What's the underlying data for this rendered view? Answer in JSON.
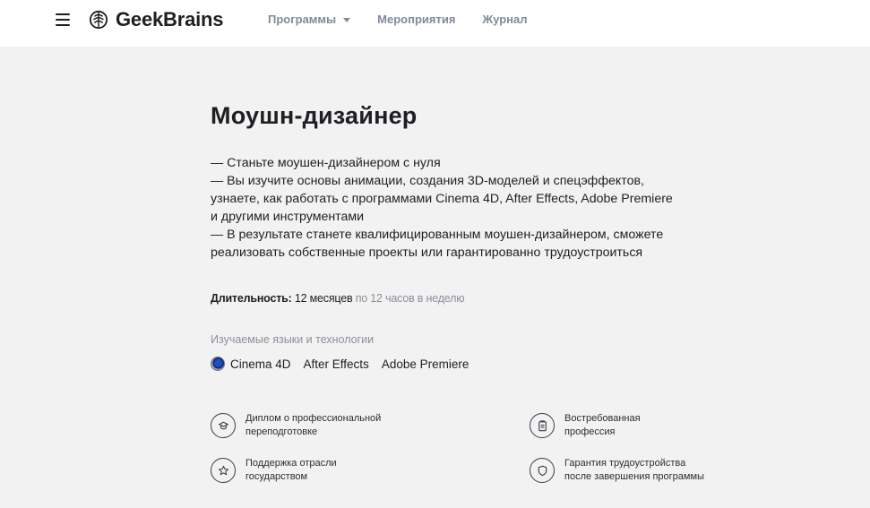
{
  "header": {
    "logo_text": "GeekBrains",
    "nav": [
      {
        "label": "Программы",
        "has_dropdown": true
      },
      {
        "label": "Мероприятия"
      },
      {
        "label": "Журнал"
      }
    ]
  },
  "main": {
    "title": "Моушн-дизайнер",
    "description": [
      "— Станьте моушен-дизайнером с нуля",
      "— Вы изучите основы анимации, создания 3D-моделей и спецэффектов, узнаете, как работать с программами Cinema 4D, After Effects, Adobe Premiere и другими инструментами",
      "— В результате станете квалифицированным моушен-дизайнером, сможете реализовать собственные проекты или гарантированно трудоустроиться"
    ],
    "duration": {
      "label": "Длительность:",
      "value": "12 месяцев",
      "extra": "по 12 часов в неделю"
    },
    "tech": {
      "title": "Изучаемые языки и технологии",
      "items": [
        "Cinema 4D",
        "After Effects",
        "Adobe Premiere"
      ]
    },
    "features": [
      {
        "icon": "graduation-icon",
        "line1": "Диплом о профессиональной",
        "line2": "переподготовке"
      },
      {
        "icon": "clipboard-icon",
        "line1": "Востребованная",
        "line2": "профессия"
      },
      {
        "icon": "star-icon",
        "line1": "Поддержка отрасли",
        "line2": "государством"
      },
      {
        "icon": "shield-icon",
        "line1": "Гарантия трудоустройства",
        "line2": "после завершения программы"
      }
    ]
  }
}
